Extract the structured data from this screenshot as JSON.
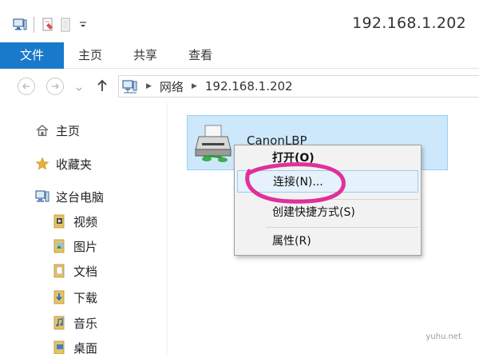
{
  "window": {
    "title": "192.168.1.202"
  },
  "ribbon": {
    "tabs": [
      {
        "label": "文件",
        "active": true
      },
      {
        "label": "主页",
        "active": false
      },
      {
        "label": "共享",
        "active": false
      },
      {
        "label": "查看",
        "active": false
      }
    ]
  },
  "address": {
    "crumbs": [
      "网络",
      "192.168.1.202"
    ]
  },
  "nav": {
    "items": [
      {
        "label": "主页",
        "icon": "home-icon"
      },
      {
        "label": "收藏夹",
        "icon": "star-icon"
      },
      {
        "label": "这台电脑",
        "icon": "computer-icon"
      },
      {
        "label": "视频",
        "icon": "video-folder-icon"
      },
      {
        "label": "图片",
        "icon": "pictures-folder-icon"
      },
      {
        "label": "文档",
        "icon": "documents-folder-icon"
      },
      {
        "label": "下载",
        "icon": "downloads-folder-icon"
      },
      {
        "label": "音乐",
        "icon": "music-folder-icon"
      },
      {
        "label": "桌面",
        "icon": "desktop-folder-icon"
      }
    ]
  },
  "content": {
    "item_name": "CanonLBP"
  },
  "context_menu": {
    "items": [
      {
        "label": "打开(O)",
        "bold": true
      },
      {
        "label": "连接(N)...",
        "highlighted": true
      },
      {
        "label": "创建快捷方式(S)"
      },
      {
        "label": "属性(R)"
      }
    ]
  },
  "watermark": "yuhu.net",
  "colors": {
    "accent": "#1979ca",
    "selection": "#cde8fb",
    "annotation": "#e0309a"
  }
}
